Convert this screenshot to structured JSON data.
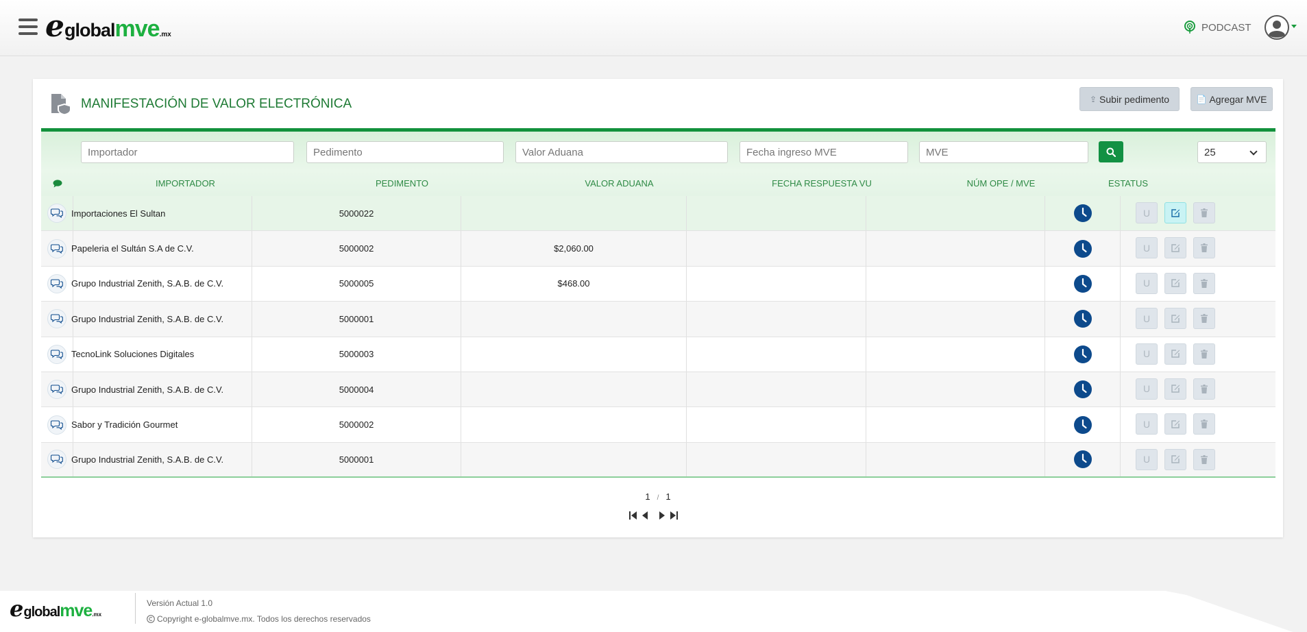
{
  "header": {
    "logo": {
      "e": "e",
      "global": "global",
      "mve": "mve",
      "mx": ".mx"
    },
    "podcast_label": "PODCAST",
    "menu_icon": "hamburger-icon",
    "avatar_icon": "user-avatar-icon"
  },
  "page": {
    "title": "MANIFESTACIÓN DE VALOR ELECTRÓNICA",
    "title_icon": "document-shield-icon",
    "upload_button": "Subir pedimento",
    "add_button": "Agregar MVE"
  },
  "filters": {
    "importador_placeholder": "Importador",
    "pedimento_placeholder": "Pedimento",
    "valor_placeholder": "Valor Aduana",
    "fecha_placeholder": "Fecha ingreso MVE",
    "mve_placeholder": "MVE",
    "per_page": "25"
  },
  "columns": {
    "importador": "IMPORTADOR",
    "pedimento": "PEDIMENTO",
    "valor": "VALOR ADUANA",
    "fecha": "FECHA RESPUESTA VU",
    "numope": "NÚM OPE / MVE",
    "estatus": "ESTATUS"
  },
  "rows": [
    {
      "importador": "Importaciones El Sultan",
      "pedimento": "5000022",
      "valor": "",
      "fecha": "",
      "numope": "",
      "status_icon": "clock-icon"
    },
    {
      "importador": "Papeleria el Sultán S.A de C.V.",
      "pedimento": "5000002",
      "valor": "$2,060.00",
      "fecha": "",
      "numope": "",
      "status_icon": "clock-icon"
    },
    {
      "importador": "Grupo Industrial Zenith, S.A.B. de C.V.",
      "pedimento": "5000005",
      "valor": "$468.00",
      "fecha": "",
      "numope": "",
      "status_icon": "clock-icon"
    },
    {
      "importador": "Grupo Industrial Zenith, S.A.B. de C.V.",
      "pedimento": "5000001",
      "valor": "",
      "fecha": "",
      "numope": "",
      "status_icon": "clock-icon"
    },
    {
      "importador": "TecnoLink Soluciones Digitales",
      "pedimento": "5000003",
      "valor": "",
      "fecha": "",
      "numope": "",
      "status_icon": "clock-icon"
    },
    {
      "importador": "Grupo Industrial Zenith, S.A.B. de C.V.",
      "pedimento": "5000004",
      "valor": "",
      "fecha": "",
      "numope": "",
      "status_icon": "clock-icon"
    },
    {
      "importador": "Sabor y Tradición Gourmet",
      "pedimento": "5000002",
      "valor": "",
      "fecha": "",
      "numope": "",
      "status_icon": "clock-icon"
    },
    {
      "importador": "Grupo Industrial Zenith, S.A.B. de C.V.",
      "pedimento": "5000001",
      "valor": "",
      "fecha": "",
      "numope": "",
      "status_icon": "clock-icon"
    }
  ],
  "row_actions": {
    "u_label": "U",
    "edit_icon": "edit-icon",
    "delete_icon": "trash-icon"
  },
  "pagination": {
    "current": "1",
    "separator": "/",
    "total": "1"
  },
  "footer": {
    "version": "Versión Actual 1.0",
    "copyright": "Copyright e-globalmve.mx. Todos los derechos reservados"
  },
  "colors": {
    "brand_green": "#12913c",
    "header_text_green": "#2e8a45",
    "status_blue": "#0d4a8c"
  }
}
